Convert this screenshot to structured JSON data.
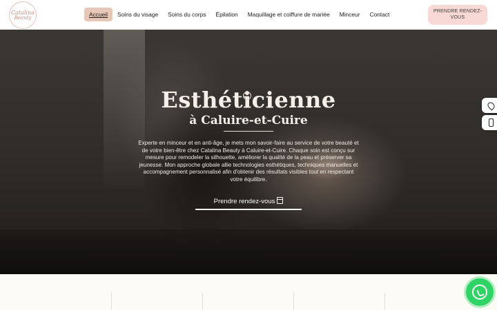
{
  "logo": {
    "line1": "Catalina",
    "line2": "Beauty"
  },
  "nav": {
    "items": [
      {
        "label": "Accueil",
        "active": true
      },
      {
        "label": "Soins du visage",
        "active": false
      },
      {
        "label": "Soins du corps",
        "active": false
      },
      {
        "label": "Épilation",
        "active": false
      },
      {
        "label": "Maquillage et coiffure de mariée",
        "active": false
      },
      {
        "label": "Minceur",
        "active": false
      },
      {
        "label": "Contact",
        "active": false
      }
    ],
    "cta_label": "PRENDRE RENDEZ-VOUS"
  },
  "hero": {
    "title": "Esthéticienne",
    "subtitle": "à Caluire-et-Cuire",
    "description": "Experte en minceur et en anti-âge, je mets mon savoir-faire au service de votre beauté et de votre bien-être chez Catalina Beauty à Caluire-et-Cuire. Chaque soin est conçu sur mesure pour remodeler la silhouette, améliorer la qualité de la peau et préserver sa jeunesse. Mon approche globale allie technologies esthétiques, techniques manuelles et accompagnement personnalisé afin d'obtenir des résultats visibles tout en respectant votre équilibre.",
    "cta_label": "Prendre rendez-vous"
  },
  "side_buttons": {
    "map_icon": "map-pin-icon",
    "phone_icon": "phone-icon"
  },
  "whatsapp": {
    "icon": "whatsapp-icon",
    "color": "#2fd366"
  },
  "colors": {
    "accent": "#e7c7b8",
    "cta_background": "#f9d9d6"
  }
}
